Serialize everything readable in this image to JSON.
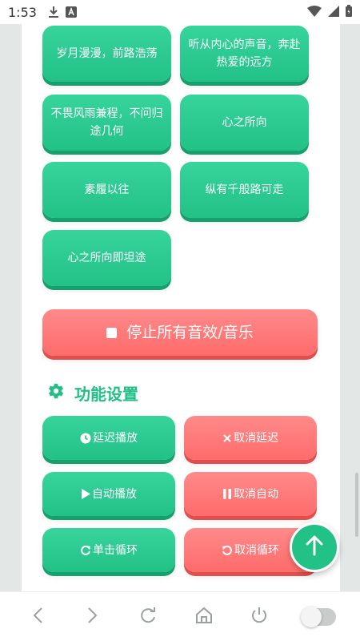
{
  "status_bar": {
    "time": "1:53",
    "icons": [
      "download-icon",
      "a-box-icon",
      "wifi-icon",
      "signal-icon",
      "battery-icon"
    ]
  },
  "sound_buttons": [
    {
      "label": "岁月漫漫，前路浩荡"
    },
    {
      "label": "听从内心的声音，奔赴热爱的远方"
    },
    {
      "label": "不畏风雨兼程，不问归途几何"
    },
    {
      "label": "心之所向"
    },
    {
      "label": "素履以往"
    },
    {
      "label": "纵有千般路可走"
    },
    {
      "label": "心之所向即坦途"
    }
  ],
  "stop_button": {
    "label": "停止所有音效/音乐"
  },
  "settings": {
    "title": "功能设置",
    "icon": "gear-icon",
    "buttons": [
      {
        "label": "延迟播放",
        "icon": "clock-icon"
      },
      {
        "label": "取消延迟",
        "icon": "x-icon"
      },
      {
        "label": "自动播放",
        "icon": "play-icon"
      },
      {
        "label": "取消自动",
        "icon": "pause-icon"
      },
      {
        "label": "单击循环",
        "icon": "redo-icon"
      },
      {
        "label": "取消循环",
        "icon": "undo-icon"
      }
    ]
  },
  "fab": {
    "icon": "arrow-up-icon"
  },
  "nav_bar": {
    "items": [
      "back-icon",
      "forward-icon",
      "refresh-icon",
      "home-icon",
      "power-icon",
      "toggle-switch"
    ]
  },
  "colors": {
    "green": "#22c186",
    "red": "#ff6b6b",
    "title_green": "#1fbf85"
  }
}
